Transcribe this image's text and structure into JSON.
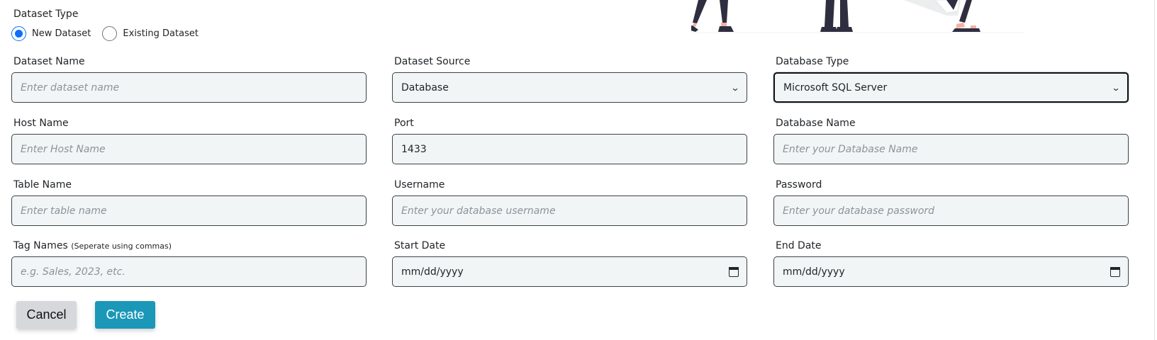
{
  "dataset_type": {
    "label": "Dataset Type",
    "options": [
      {
        "label": "New Dataset",
        "checked": true
      },
      {
        "label": "Existing Dataset",
        "checked": false
      }
    ]
  },
  "fields": {
    "dataset_name": {
      "label": "Dataset Name",
      "placeholder": "Enter dataset name",
      "value": ""
    },
    "dataset_source": {
      "label": "Dataset Source",
      "value": "Database"
    },
    "database_type": {
      "label": "Database Type",
      "value": "Microsoft SQL Server"
    },
    "host_name": {
      "label": "Host Name",
      "placeholder": "Enter Host Name",
      "value": ""
    },
    "port": {
      "label": "Port",
      "value": "1433"
    },
    "database_name": {
      "label": "Database Name",
      "placeholder": "Enter your Database Name",
      "value": ""
    },
    "table_name": {
      "label": "Table Name",
      "placeholder": "Enter table name",
      "value": ""
    },
    "username": {
      "label": "Username",
      "placeholder": "Enter your database username",
      "value": ""
    },
    "password": {
      "label": "Password",
      "placeholder": "Enter your database password",
      "value": ""
    },
    "tag_names": {
      "label": "Tag Names",
      "hint": "(Seperate using commas)",
      "placeholder": "e.g. Sales, 2023, etc.",
      "value": ""
    },
    "start_date": {
      "label": "Start Date",
      "value": "mm/dd/yyyy"
    },
    "end_date": {
      "label": "End Date",
      "value": "mm/dd/yyyy"
    }
  },
  "buttons": {
    "cancel": "Cancel",
    "create": "Create"
  },
  "colors": {
    "accent": "#0d6efd",
    "create_button": "#1b97b8",
    "cancel_button": "#d6d8db",
    "input_bg": "#f2f5f5"
  },
  "icons": {
    "select": "chevron-down-icon",
    "date": "calendar-icon"
  }
}
